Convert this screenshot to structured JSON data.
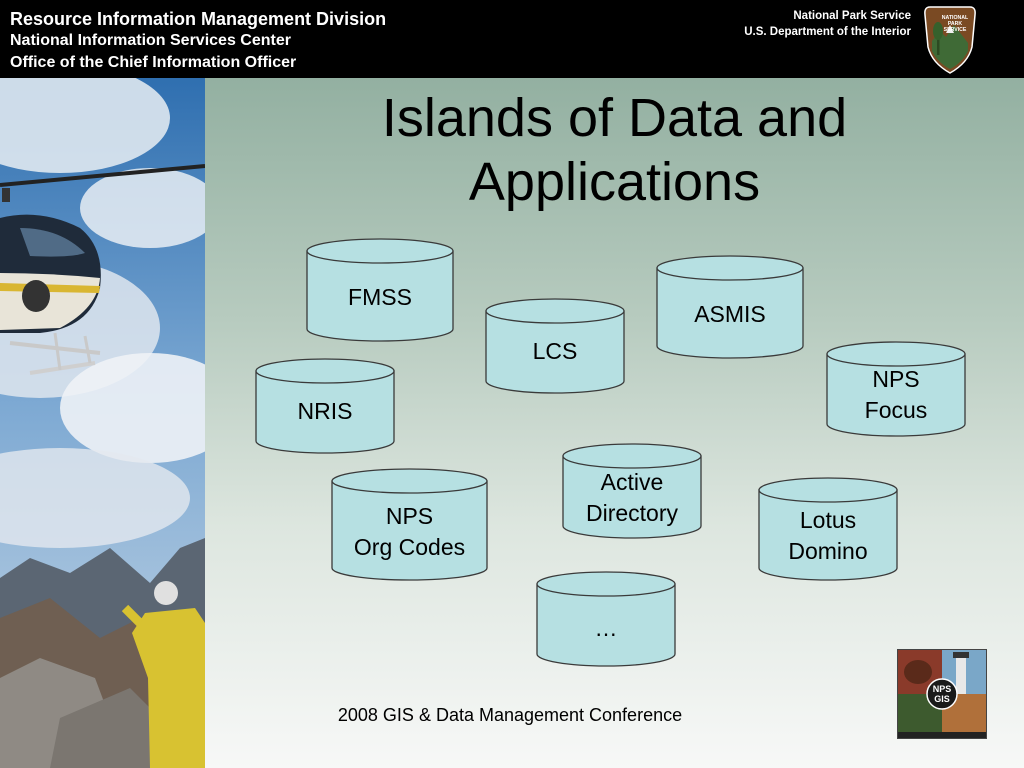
{
  "header": {
    "line1": "Resource Information Management Division",
    "line2": "National Information Services Center",
    "line3": "Office of the Chief Information Officer",
    "agency": "National Park Service",
    "department": "U.S. Department of the Interior",
    "arrowhead_text": [
      "NATIONAL",
      "PARK",
      "SERVICE"
    ]
  },
  "title": {
    "line1": "Islands of Data and",
    "line2": "Applications"
  },
  "cylinders": [
    {
      "id": "fmss",
      "lines": [
        "FMSS"
      ]
    },
    {
      "id": "asmis",
      "lines": [
        "ASMIS"
      ]
    },
    {
      "id": "lcs",
      "lines": [
        "LCS"
      ]
    },
    {
      "id": "nris",
      "lines": [
        "NRIS"
      ]
    },
    {
      "id": "nps-focus",
      "lines": [
        "NPS",
        "Focus"
      ]
    },
    {
      "id": "active-directory",
      "lines": [
        "Active",
        "Directory"
      ]
    },
    {
      "id": "nps-org-codes",
      "lines": [
        "NPS",
        "Org Codes"
      ]
    },
    {
      "id": "lotus-domino",
      "lines": [
        "Lotus",
        "Domino"
      ]
    },
    {
      "id": "ellipsis",
      "lines": [
        "…"
      ]
    }
  ],
  "footer": "2008 GIS & Data Management Conference",
  "gis_logo_text": [
    "NPS",
    "GIS"
  ],
  "colors": {
    "header_bg": "#000000",
    "cylinder_fill": "#b6e0e2",
    "cylinder_stroke": "#3a3a3a"
  }
}
